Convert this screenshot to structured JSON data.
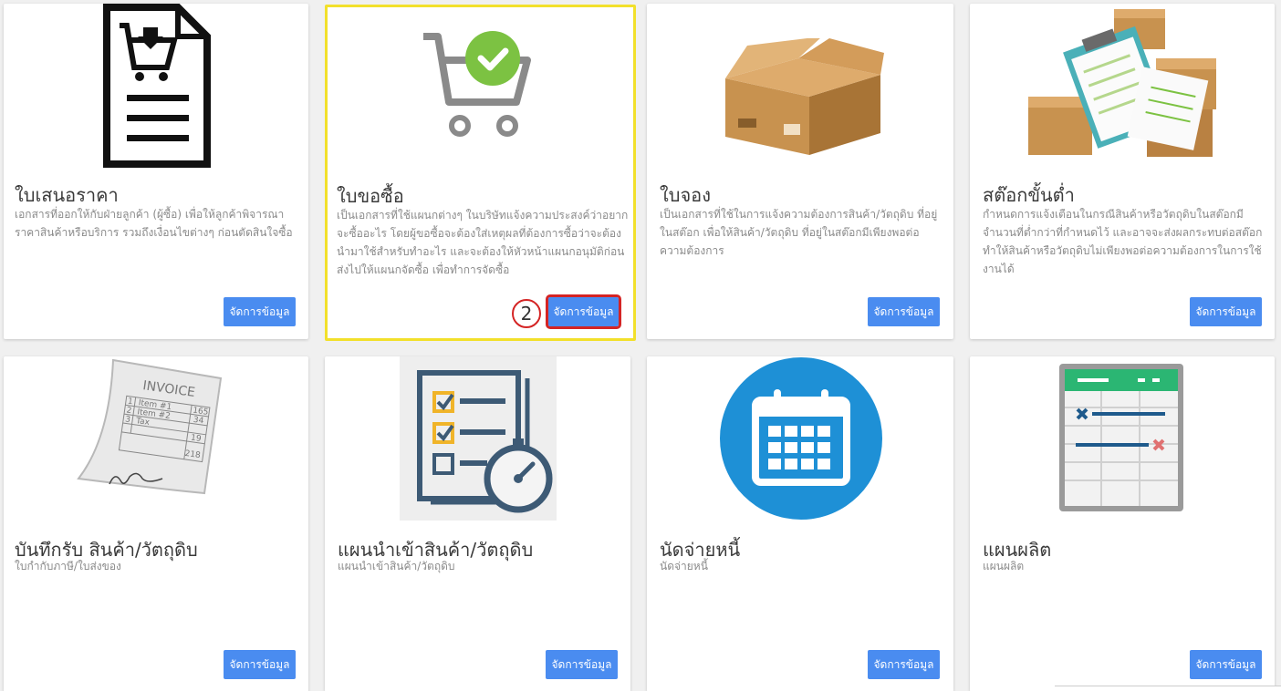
{
  "cards": [
    {
      "title": "ใบเสนอราคา",
      "desc": "เอกสารที่ออกให้กับฝ่ายลูกค้า (ผู้ซื้อ) เพื่อให้ลูกค้าพิจารณาราคาสินค้าหรือบริการ รวมถึงเงื่อนไขต่างๆ ก่อนตัดสินใจซื้อ",
      "button": "จัดการข้อมูล",
      "icon": "quotation-document-icon"
    },
    {
      "title": "ใบขอซื้อ",
      "desc": "เป็นเอกสารที่ใช้แผนกต่างๆ ในบริษัทแจ้งความประสงค์ว่าอยากจะซื้ออะไร โดยผู้ขอซื้อจะต้องใส่เหตุผลที่ต้องการซื้อว่าจะต้องนำมาใช้สำหรับทำอะไร และจะต้องให้หัวหน้าแผนกอนุมัติก่อนส่งไปให้แผนกจัดซื้อ เพื่อทำการจัดซื้อ",
      "button": "จัดการข้อมูล",
      "icon": "cart-check-icon",
      "step": "2"
    },
    {
      "title": "ใบจอง",
      "desc": "เป็นเอกสารที่ใช้ในการแจ้งความต้องการสินค้า/วัตถุดิบ ที่อยู่ในสต๊อก เพื่อให้สินค้า/วัตถุดิบ ที่อยู่ในสต๊อกมีเพียงพอต่อความต้องการ",
      "button": "จัดการข้อมูล",
      "icon": "cardboard-box-icon"
    },
    {
      "title": "สต๊อกขั้นต่ำ",
      "desc": "กำหนดการแจ้งเตือนในกรณีสินค้าหรือวัตถุดิบในสต๊อกมีจำนวนที่ต่ำกว่าที่กำหนดไว้ และอาจจะส่งผลกระทบต่อสต๊อกทำให้สินค้าหรือวัตถุดิบไม่เพียงพอต่อความต้องการในการใช้งานได้",
      "button": "จัดการข้อมูล",
      "icon": "stock-clipboard-icon"
    },
    {
      "title": "บันทึกรับ สินค้า/วัตถุดิบ",
      "desc": "ใบกำกับภาษี/ใบส่งของ",
      "button": "จัดการข้อมูล",
      "icon": "invoice-paper-icon",
      "invoice_lines": [
        "INVOICE",
        "1",
        "Item #1",
        "165",
        "2",
        "Item #2",
        "34",
        "3",
        "Tax",
        "19",
        "218"
      ]
    },
    {
      "title": "แผนนำเข้าสินค้า/วัตถุดิบ",
      "desc": "แผนนำเข้าสินค้า/วัตถุดิบ",
      "button": "จัดการข้อมูล",
      "icon": "checklist-stopwatch-icon"
    },
    {
      "title": "นัดจ่ายหนี้",
      "desc": "นัดจ่ายหนี้",
      "button": "จัดการข้อมูล",
      "icon": "calendar-icon"
    },
    {
      "title": "แผนผลิต",
      "desc": "แผนผลิต",
      "button": "จัดการข้อมูล",
      "icon": "spreadsheet-plan-icon"
    }
  ],
  "colors": {
    "button": "#4a8cf0",
    "highlight_border": "#f2e02b",
    "annotation_red": "#d42424",
    "check_green": "#7cc242",
    "calendar_blue": "#1e90d6"
  }
}
